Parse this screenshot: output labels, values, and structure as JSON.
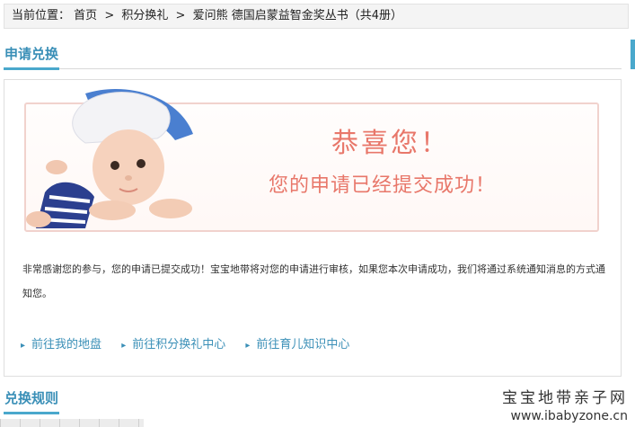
{
  "breadcrumb": {
    "prefix": "当前位置：",
    "items": [
      "首页",
      "积分换礼",
      "爱问熊 德国启蒙益智金奖丛书（共4册）"
    ],
    "separator": ">"
  },
  "section_apply": {
    "title": "申请兑换"
  },
  "banner": {
    "congrats": "恭喜您！",
    "success": "您的申请已经提交成功！"
  },
  "message": {
    "text": "非常感谢您的参与，您的申请已提交成功！宝宝地带将对您的申请进行审核，如果您本次申请成功，我们将通过系统通知消息的方式通知您。"
  },
  "links": {
    "my_site": "前往我的地盘",
    "points_center": "前往积分换礼中心",
    "parenting_center": "前往育儿知识中心"
  },
  "section_rules": {
    "title": "兑换规则"
  },
  "watermark": {
    "name": "宝宝地带亲子网",
    "url": "www.ibabyzone.cn"
  },
  "colors": {
    "accent": "#3a8fb7",
    "banner_text": "#e8776a"
  }
}
